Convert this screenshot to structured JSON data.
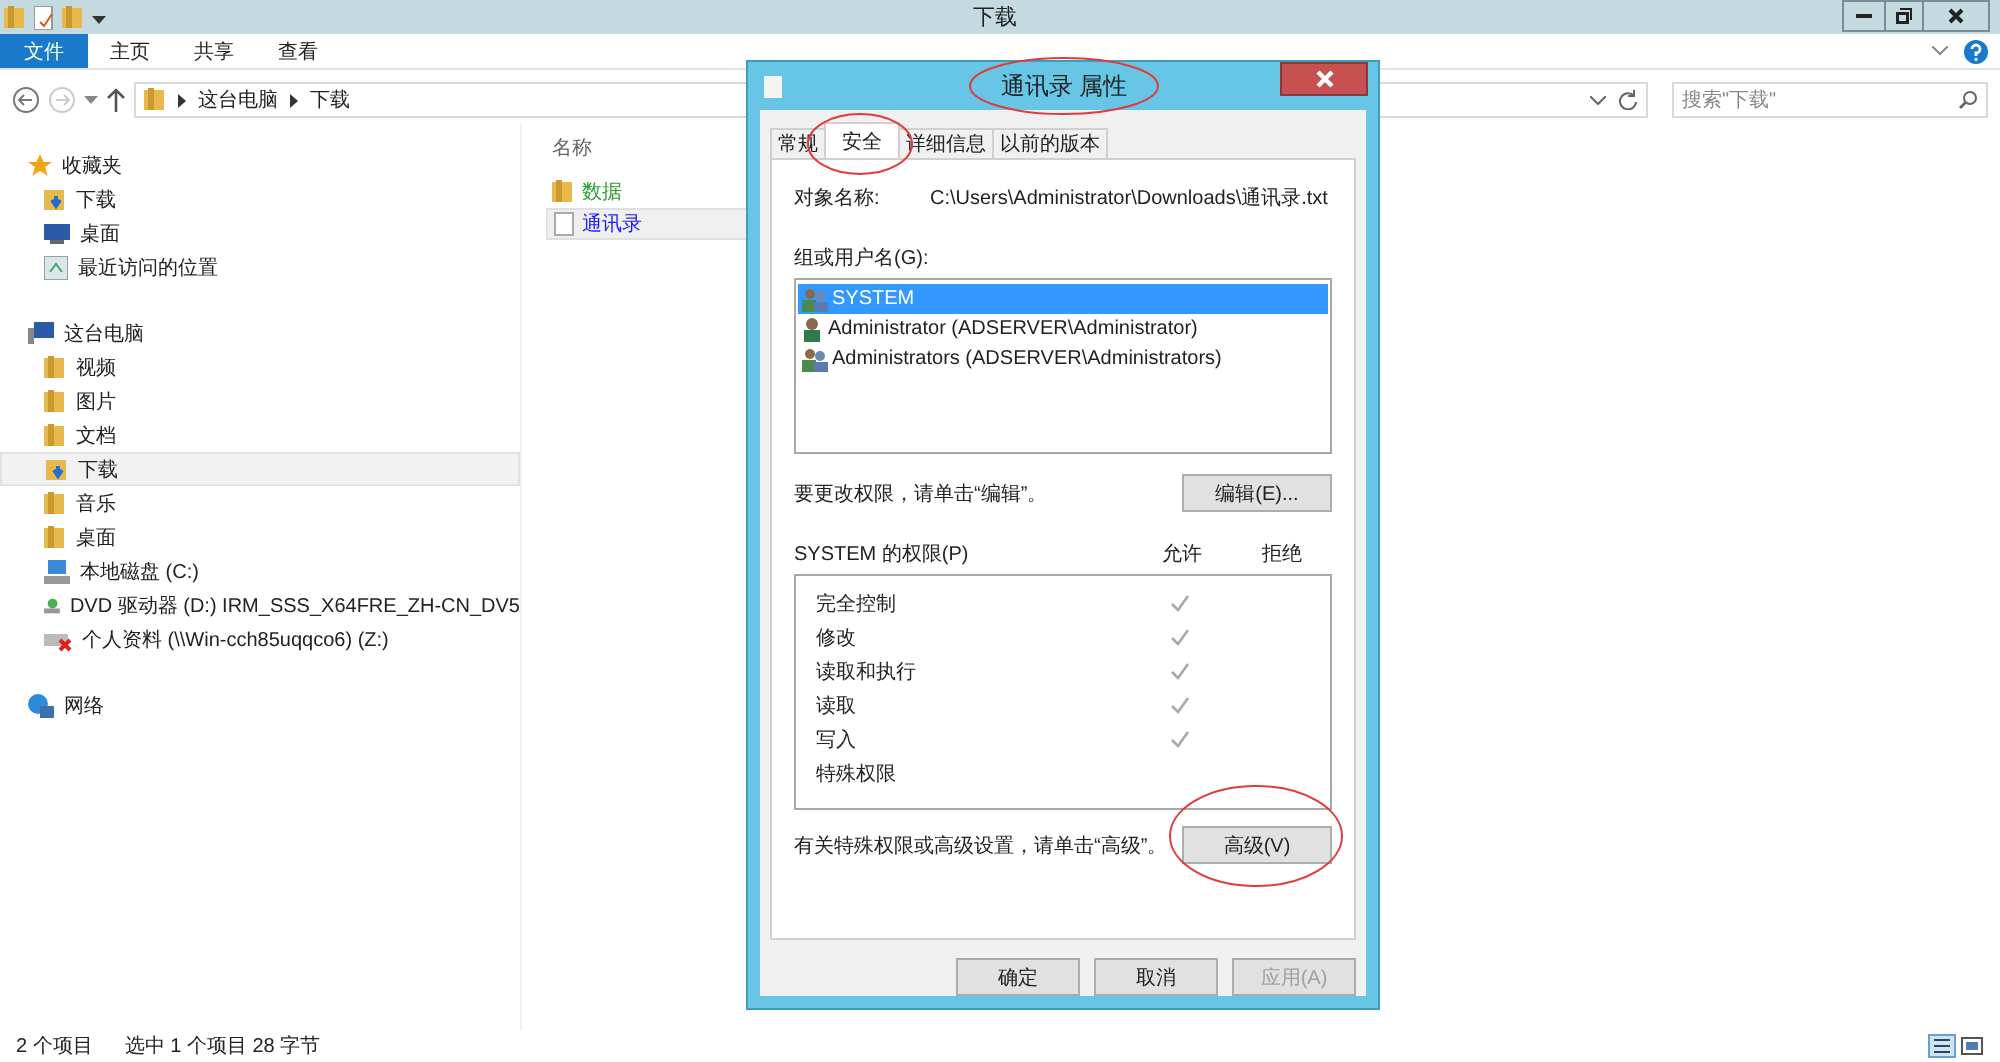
{
  "window": {
    "title": "下载"
  },
  "ribbon": [
    {
      "label": "文件",
      "kind": "file"
    },
    {
      "label": "主页",
      "kind": "tab"
    },
    {
      "label": "共享",
      "kind": "tab"
    },
    {
      "label": "查看",
      "kind": "tab"
    }
  ],
  "address_bar": {
    "path": [
      "这台电脑",
      "下载"
    ]
  },
  "search": {
    "placeholder": "搜索\"下载\""
  },
  "nav_pane": [
    {
      "label": "收藏夹",
      "kind": "star",
      "selected": false,
      "children": [
        {
          "label": "下载",
          "kind": "download",
          "selected": false
        },
        {
          "label": "桌面",
          "kind": "desktop",
          "selected": false
        },
        {
          "label": "最近访问的位置",
          "kind": "recent",
          "selected": false
        }
      ]
    },
    {
      "label": "这台电脑",
      "kind": "computer",
      "selected": false,
      "children": [
        {
          "label": "视频",
          "kind": "folder",
          "selected": false
        },
        {
          "label": "图片",
          "kind": "folder",
          "selected": false
        },
        {
          "label": "文档",
          "kind": "folder",
          "selected": false
        },
        {
          "label": "下载",
          "kind": "download",
          "selected": true
        },
        {
          "label": "音乐",
          "kind": "folder",
          "selected": false
        },
        {
          "label": "桌面",
          "kind": "folder",
          "selected": false
        },
        {
          "label": "本地磁盘 (C:)",
          "kind": "disk",
          "selected": false
        },
        {
          "label": "DVD 驱动器 (D:) IRM_SSS_X64FRE_ZH-CN_DV5",
          "kind": "dvd",
          "selected": false
        },
        {
          "label": "个人资料 (\\\\Win-cch85uqqco6) (Z:)",
          "kind": "netdrive",
          "selected": false
        }
      ]
    },
    {
      "label": "网络",
      "kind": "network",
      "selected": false
    }
  ],
  "file_list": {
    "columns": [
      "名称"
    ],
    "items": [
      {
        "name": "数据",
        "kind": "folder",
        "color": "#2e9e2e",
        "selected": false
      },
      {
        "name": "通讯录",
        "kind": "file",
        "color": "#1a1aff",
        "selected": true
      }
    ]
  },
  "status_bar": {
    "item_count": "2 个项目",
    "selection": "选中 1 个项目 28 字节"
  },
  "dialog": {
    "title": "通讯录 属性",
    "tabs": [
      {
        "label": "常规",
        "selected": false
      },
      {
        "label": "安全",
        "selected": true
      },
      {
        "label": "详细信息",
        "selected": false
      },
      {
        "label": "以前的版本",
        "selected": false
      }
    ],
    "object_name_label": "对象名称:",
    "object_name": "C:\\Users\\Administrator\\Downloads\\通讯录.txt",
    "groups_label": "组或用户名(G):",
    "groups": [
      {
        "name": "SYSTEM",
        "kind": "group",
        "selected": true
      },
      {
        "name": "Administrator (ADSERVER\\Administrator)",
        "kind": "user",
        "selected": false
      },
      {
        "name": "Administrators (ADSERVER\\Administrators)",
        "kind": "group",
        "selected": false
      }
    ],
    "edit_hint": "要更改权限，请单击“编辑”。",
    "edit_button": "编辑(E)...",
    "permissions_label": "SYSTEM 的权限(P)",
    "allow_header": "允许",
    "deny_header": "拒绝",
    "permissions": [
      {
        "name": "完全控制",
        "allow": true
      },
      {
        "name": "修改",
        "allow": true
      },
      {
        "name": "读取和执行",
        "allow": true
      },
      {
        "name": "读取",
        "allow": true
      },
      {
        "name": "写入",
        "allow": true
      },
      {
        "name": "特殊权限",
        "allow": false
      }
    ],
    "advanced_hint": "有关特殊权限或高级设置，请单击“高级”。",
    "advanced_button": "高级(V)",
    "buttons": [
      {
        "label": "确定",
        "disabled": false
      },
      {
        "label": "取消",
        "disabled": false
      },
      {
        "label": "应用(A)",
        "disabled": true
      }
    ]
  }
}
